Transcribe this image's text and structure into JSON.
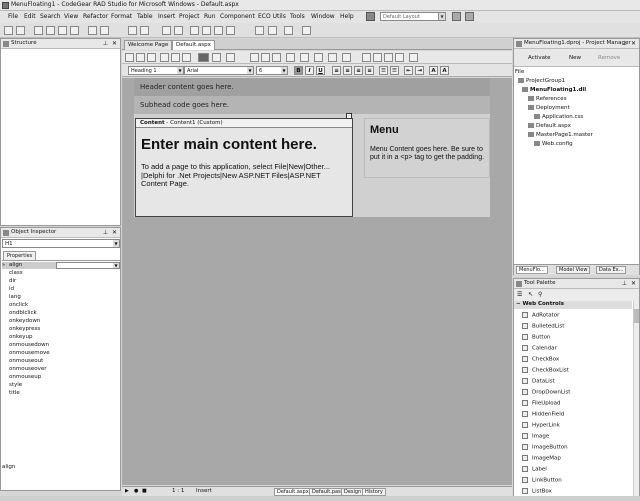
{
  "window": {
    "title": "MenuFloating1 - CodeGear RAD Studio for Microsoft Windows - Default.aspx"
  },
  "menu": [
    "File",
    "Edit",
    "Search",
    "View",
    "Refactor",
    "Format",
    "Table",
    "Insert",
    "Project",
    "Run",
    "Component",
    "ECO Utils",
    "Tools",
    "Window",
    "Help"
  ],
  "layout_select": "Default Layout",
  "structure": {
    "title": "Structure"
  },
  "object_inspector": {
    "title": "Object Inspector",
    "selected": "H1",
    "tab": "Properties",
    "properties": [
      "align",
      "class",
      "dir",
      "id",
      "lang",
      "onclick",
      "ondblclick",
      "onkeydown",
      "onkeypress",
      "onkeyup",
      "onmousedown",
      "onmousemove",
      "onmouseout",
      "onmouseover",
      "onmouseup",
      "style",
      "title"
    ],
    "footer": "align"
  },
  "editor": {
    "tabs": [
      "Welcome Page",
      "Default.aspx"
    ],
    "format": {
      "style": "Heading 1",
      "font": "Arial",
      "size": "6"
    },
    "header_text": "Header content goes here.",
    "subhead_text": "Subhead code goes here.",
    "content_label": "Content",
    "content_id": " - Content1 (Custom)",
    "heading": "Enter main content here.",
    "body_text": "To add a page to this application, select File|New|Other... |Delphi for .Net Projects|New ASP.NET Files|ASP.NET Content Page.",
    "menu_heading": "Menu",
    "menu_text": "Menu Content goes here. Be sure to put it in a <p> tag to get the padding."
  },
  "status": {
    "position": "1 : 1",
    "mode": "Insert",
    "tabs": [
      "Default.aspx",
      "Default.pas",
      "Design",
      "History"
    ]
  },
  "project_manager": {
    "title": "MenuFloating1.dproj - Project Manager",
    "toolbar": [
      "Activate",
      "New",
      "Remove"
    ],
    "file_label": "File",
    "tree": [
      "ProjectGroup1",
      "MenuFloating1.dll",
      "References",
      "Deployment",
      "Application.css",
      "Default.aspx",
      "MasterPage1.master",
      "Web.config"
    ],
    "bottom_tabs": [
      "MenuFlo...",
      "Model View",
      "Data Ex..."
    ]
  },
  "tool_palette": {
    "title": "Tool Palette",
    "category": "Web Controls",
    "items": [
      "AdRotator",
      "BulletedList",
      "Button",
      "Calendar",
      "CheckBox",
      "CheckBoxList",
      "DataList",
      "DropDownList",
      "FileUpload",
      "HiddenField",
      "HyperLink",
      "Image",
      "ImageButton",
      "ImageMap",
      "Label",
      "LinkButton",
      "ListBox"
    ]
  }
}
